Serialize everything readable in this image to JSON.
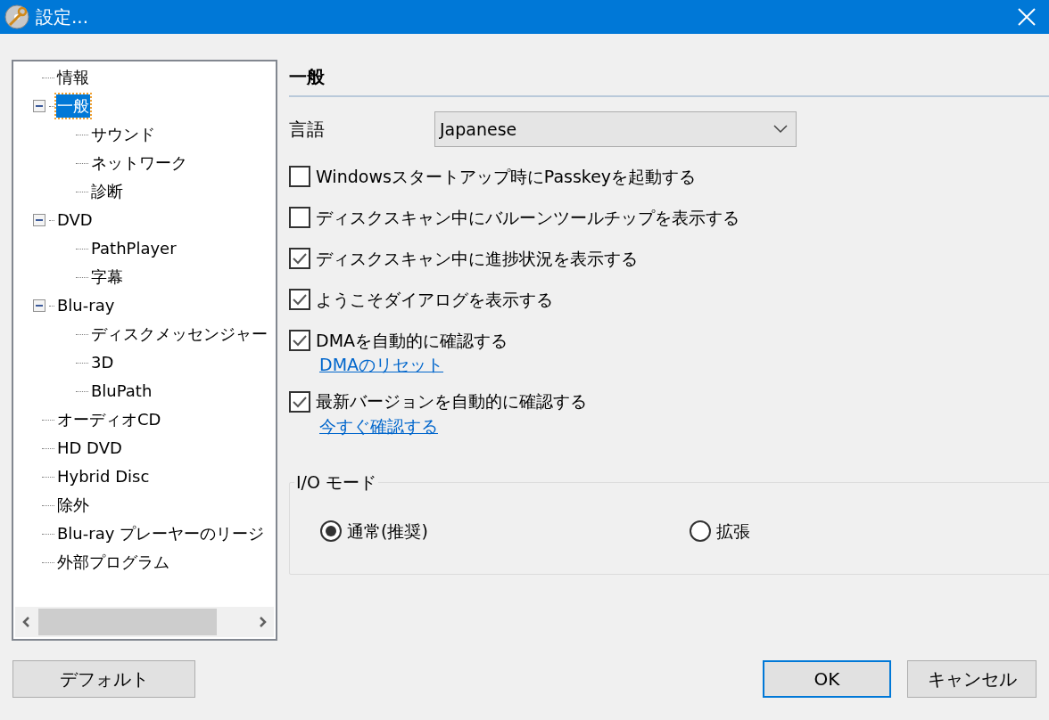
{
  "window": {
    "title": "設定..."
  },
  "tree": {
    "items": [
      {
        "label": "情報",
        "selected": false
      },
      {
        "label": "一般",
        "selected": true,
        "expanded": true,
        "children": [
          {
            "label": "サウンド",
            "selected": false
          },
          {
            "label": "ネットワーク",
            "selected": false
          },
          {
            "label": "診断",
            "selected": false
          }
        ]
      },
      {
        "label": "DVD",
        "selected": false,
        "expanded": true,
        "children": [
          {
            "label": "PathPlayer",
            "selected": false
          },
          {
            "label": "字幕",
            "selected": false
          }
        ]
      },
      {
        "label": "Blu-ray",
        "selected": false,
        "expanded": true,
        "children": [
          {
            "label": "ディスクメッセンジャー",
            "selected": false
          },
          {
            "label": "3D",
            "selected": false
          },
          {
            "label": "BluPath",
            "selected": false
          }
        ]
      },
      {
        "label": "オーディオCD",
        "selected": false
      },
      {
        "label": "HD DVD",
        "selected": false
      },
      {
        "label": "Hybrid Disc",
        "selected": false
      },
      {
        "label": "除外",
        "selected": false
      },
      {
        "label": "Blu-ray プレーヤーのリージ",
        "selected": false
      },
      {
        "label": "外部プログラム",
        "selected": false
      }
    ]
  },
  "section": {
    "title": "一般",
    "language": {
      "label": "言語",
      "value": "Japanese"
    },
    "options": [
      {
        "label": "Windowsスタートアップ時にPasskeyを起動する",
        "checked": false
      },
      {
        "label": "ディスクスキャン中にバルーンツールチップを表示する",
        "checked": false
      },
      {
        "label": "ディスクスキャン中に進捗状況を表示する",
        "checked": true
      },
      {
        "label": "ようこそダイアログを表示する",
        "checked": true
      },
      {
        "label": "DMAを自動的に確認する",
        "checked": true,
        "link": "DMAのリセット"
      },
      {
        "label": "最新バージョンを自動的に確認する",
        "checked": true,
        "link": "今すぐ確認する"
      }
    ],
    "io_mode": {
      "title": "I/O モード",
      "options": [
        {
          "label": "通常(推奨)",
          "selected": true
        },
        {
          "label": "拡張",
          "selected": false
        }
      ]
    }
  },
  "buttons": {
    "default": "デフォルト",
    "ok": "OK",
    "cancel": "キャンセル"
  }
}
